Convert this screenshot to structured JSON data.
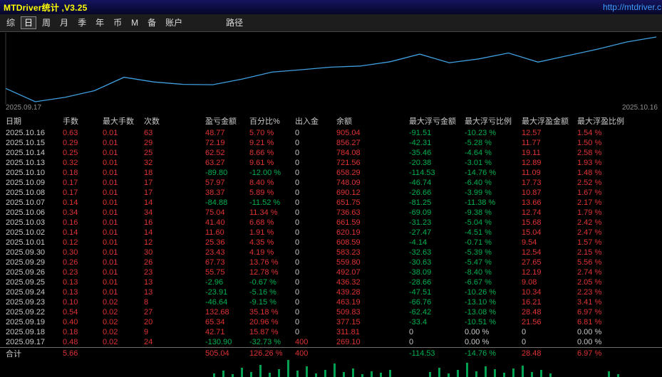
{
  "title_bar": {
    "title": "MTDriver统计 ,V3.25",
    "url": "http://mtdriver.c"
  },
  "menu": {
    "items": [
      {
        "label": "综",
        "selected": false
      },
      {
        "label": "日",
        "selected": true
      },
      {
        "label": "周",
        "selected": false
      },
      {
        "label": "月",
        "selected": false
      },
      {
        "label": "季",
        "selected": false
      },
      {
        "label": "年",
        "selected": false
      },
      {
        "label": "币",
        "selected": false
      },
      {
        "label": "M",
        "selected": false
      },
      {
        "label": "备",
        "selected": false
      },
      {
        "label": "账户",
        "selected": false
      },
      {
        "label": "路径",
        "selected": false,
        "gap_before": true
      }
    ]
  },
  "colors": {
    "positive": "#e03232",
    "negative": "#00b050",
    "neutral": "#c8c8c8",
    "line": "#3f9fdf",
    "title": "#ffff00",
    "link": "#3d9bff",
    "volume": "#00a050"
  },
  "chart_data": {
    "type": "line",
    "title": "",
    "xlabel": "",
    "ylabel": "",
    "legend": "none",
    "grid": false,
    "x_axis_labels": [
      "2025.09.17",
      "2025.10.16"
    ],
    "initial_value": 400,
    "dates": [
      "2025.09.17",
      "2025.09.18",
      "2025.09.19",
      "2025.09.22",
      "2025.09.23",
      "2025.09.24",
      "2025.09.25",
      "2025.09.26",
      "2025.09.29",
      "2025.09.30",
      "2025.10.01",
      "2025.10.02",
      "2025.10.03",
      "2025.10.06",
      "2025.10.07",
      "2025.10.08",
      "2025.10.09",
      "2025.10.10",
      "2025.10.13",
      "2025.10.14",
      "2025.10.15",
      "2025.10.16"
    ],
    "balances": [
      269.1,
      311.81,
      377.15,
      509.83,
      463.19,
      439.28,
      436.32,
      492.07,
      559.8,
      583.23,
      608.59,
      620.19,
      661.59,
      736.63,
      651.75,
      690.12,
      748.09,
      658.29,
      721.56,
      784.08,
      856.27,
      905.04
    ],
    "ylim": [
      269.1,
      905.04
    ]
  },
  "table": {
    "columns": [
      "日期",
      "手数",
      "最大手数",
      "次数",
      "盈亏金额",
      "百分比%",
      "出入金",
      "余额",
      "最大浮亏金额",
      "最大浮亏比例",
      "最大浮盈金额",
      "最大浮盈比例"
    ],
    "rows": [
      [
        "2025.10.16",
        "0.63",
        "0.01",
        "63",
        "48.77",
        "5.70 %",
        "0",
        "905.04",
        "-91.51",
        "-10.23 %",
        "12.57",
        "1.54 %"
      ],
      [
        "2025.10.15",
        "0.29",
        "0.01",
        "29",
        "72.19",
        "9.21 %",
        "0",
        "856.27",
        "-42.31",
        "-5.28 %",
        "11.77",
        "1.50 %"
      ],
      [
        "2025.10.14",
        "0.25",
        "0.01",
        "25",
        "62.52",
        "8.66 %",
        "0",
        "784.08",
        "-35.46",
        "-4.64 %",
        "19.11",
        "2.58 %"
      ],
      [
        "2025.10.13",
        "0.32",
        "0.01",
        "32",
        "63.27",
        "9.61 %",
        "0",
        "721.56",
        "-20.38",
        "-3.01 %",
        "12.89",
        "1.93 %"
      ],
      [
        "2025.10.10",
        "0.18",
        "0.01",
        "18",
        "-89.80",
        "-12.00 %",
        "0",
        "658.29",
        "-114.53",
        "-14.76 %",
        "11.09",
        "1.48 %"
      ],
      [
        "2025.10.09",
        "0.17",
        "0.01",
        "17",
        "57.97",
        "8.40 %",
        "0",
        "748.09",
        "-46.74",
        "-6.40 %",
        "17.73",
        "2.52 %"
      ],
      [
        "2025.10.08",
        "0.17",
        "0.01",
        "17",
        "38.37",
        "5.89 %",
        "0",
        "690.12",
        "-26.66",
        "-3.99 %",
        "10.87",
        "1.67 %"
      ],
      [
        "2025.10.07",
        "0.14",
        "0.01",
        "14",
        "-84.88",
        "-11.52 %",
        "0",
        "651.75",
        "-81.25",
        "-11.38 %",
        "13.66",
        "2.17 %"
      ],
      [
        "2025.10.06",
        "0.34",
        "0.01",
        "34",
        "75.04",
        "11.34 %",
        "0",
        "736.63",
        "-69.09",
        "-9.38 %",
        "12.74",
        "1.79 %"
      ],
      [
        "2025.10.03",
        "0.16",
        "0.01",
        "16",
        "41.40",
        "6.68 %",
        "0",
        "661.59",
        "-31.23",
        "-5.04 %",
        "15.68",
        "2.42 %"
      ],
      [
        "2025.10.02",
        "0.14",
        "0.01",
        "14",
        "11.60",
        "1.91 %",
        "0",
        "620.19",
        "-27.47",
        "-4.51 %",
        "15.04",
        "2.47 %"
      ],
      [
        "2025.10.01",
        "0.12",
        "0.01",
        "12",
        "25.36",
        "4.35 %",
        "0",
        "608.59",
        "-4.14",
        "-0.71 %",
        "9.54",
        "1.57 %"
      ],
      [
        "2025.09.30",
        "0.30",
        "0.01",
        "30",
        "23.43",
        "4.19 %",
        "0",
        "583.23",
        "-32.63",
        "-5.39 %",
        "12.54",
        "2.15 %"
      ],
      [
        "2025.09.29",
        "0.26",
        "0.01",
        "26",
        "67.73",
        "13.76 %",
        "0",
        "559.80",
        "-30.63",
        "-5.47 %",
        "27.65",
        "5.56 %"
      ],
      [
        "2025.09.26",
        "0.23",
        "0.01",
        "23",
        "55.75",
        "12.78 %",
        "0",
        "492.07",
        "-38.09",
        "-8.40 %",
        "12.19",
        "2.74 %"
      ],
      [
        "2025.09.25",
        "0.13",
        "0.01",
        "13",
        "-2.96",
        "-0.67 %",
        "0",
        "436.32",
        "-28.66",
        "-6.67 %",
        "9.08",
        "2.05 %"
      ],
      [
        "2025.09.24",
        "0.13",
        "0.01",
        "13",
        "-23.91",
        "-5.16 %",
        "0",
        "439.28",
        "-47.51",
        "-10.26 %",
        "10.34",
        "2.23 %"
      ],
      [
        "2025.09.23",
        "0.10",
        "0.02",
        "8",
        "-46.64",
        "-9.15 %",
        "0",
        "463.19",
        "-66.76",
        "-13.10 %",
        "16.21",
        "3.41 %"
      ],
      [
        "2025.09.22",
        "0.54",
        "0.02",
        "27",
        "132.68",
        "35.18 %",
        "0",
        "509.83",
        "-62.42",
        "-13.08 %",
        "28.48",
        "6.97 %"
      ],
      [
        "2025.09.19",
        "0.40",
        "0.02",
        "20",
        "65.34",
        "20.96 %",
        "0",
        "377.15",
        "-33.4",
        "-10.51 %",
        "21.56",
        "6.81 %"
      ],
      [
        "2025.09.18",
        "0.18",
        "0.02",
        "9",
        "42.71",
        "15.87 %",
        "0",
        "311.81",
        "0",
        "0.00 %",
        "0",
        "0.00 %"
      ],
      [
        "2025.09.17",
        "0.48",
        "0.02",
        "24",
        "-130.90",
        "-32.73 %",
        "400",
        "269.10",
        "0",
        "0.00 %",
        "0",
        "0.00 %"
      ]
    ],
    "total_row": [
      "合计",
      "5.66",
      "",
      "",
      "505.04",
      "126.26 %",
      "400",
      "",
      "-114.53",
      "-14.76 %",
      "28.48",
      "6.97 %"
    ]
  },
  "volume_strip": {
    "bars": [
      [
        0.322,
        5
      ],
      [
        0.336,
        9
      ],
      [
        0.35,
        4
      ],
      [
        0.364,
        13
      ],
      [
        0.378,
        7
      ],
      [
        0.392,
        17
      ],
      [
        0.406,
        6
      ],
      [
        0.42,
        11
      ],
      [
        0.434,
        24
      ],
      [
        0.448,
        9
      ],
      [
        0.462,
        15
      ],
      [
        0.476,
        5
      ],
      [
        0.49,
        10
      ],
      [
        0.504,
        19
      ],
      [
        0.518,
        7
      ],
      [
        0.532,
        12
      ],
      [
        0.546,
        4
      ],
      [
        0.56,
        8
      ],
      [
        0.574,
        6
      ],
      [
        0.588,
        10
      ],
      [
        0.648,
        7
      ],
      [
        0.662,
        13
      ],
      [
        0.676,
        5
      ],
      [
        0.69,
        10
      ],
      [
        0.704,
        20
      ],
      [
        0.718,
        8
      ],
      [
        0.732,
        15
      ],
      [
        0.746,
        11
      ],
      [
        0.76,
        6
      ],
      [
        0.774,
        12
      ],
      [
        0.788,
        16
      ],
      [
        0.802,
        7
      ],
      [
        0.816,
        10
      ],
      [
        0.83,
        5
      ],
      [
        0.918,
        8
      ],
      [
        0.932,
        4
      ]
    ]
  }
}
